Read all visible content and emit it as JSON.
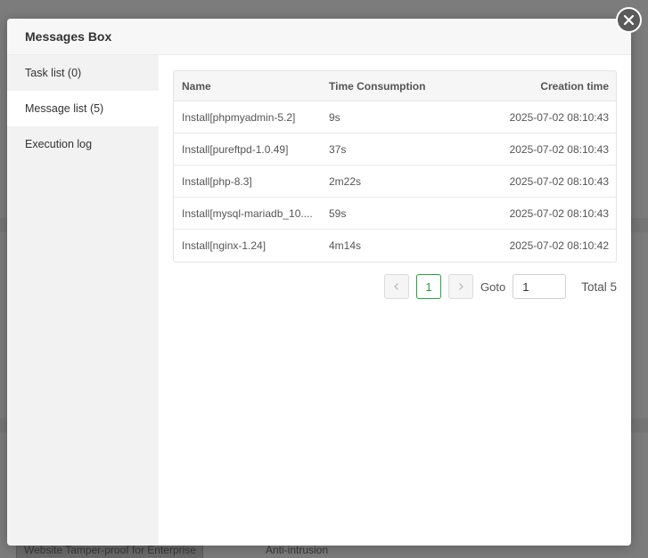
{
  "background": {
    "bottom_left_text": "Website Tamper-proof for Enterprise",
    "bottom_mid_text": "Anti-intrusion"
  },
  "dialog": {
    "title": "Messages Box",
    "close_icon": "close-icon"
  },
  "sidebar": {
    "items": [
      {
        "label": "Task list (0)",
        "active": false
      },
      {
        "label": "Message list (5)",
        "active": true
      },
      {
        "label": "Execution log",
        "active": false
      }
    ]
  },
  "table": {
    "headers": {
      "name": "Name",
      "time": "Time Consumption",
      "created": "Creation time"
    },
    "rows": [
      {
        "name": "Install[phpmyadmin-5.2]",
        "time": "9s",
        "created": "2025-07-02 08:10:43"
      },
      {
        "name": "Install[pureftpd-1.0.49]",
        "time": "37s",
        "created": "2025-07-02 08:10:43"
      },
      {
        "name": "Install[php-8.3]",
        "time": "2m22s",
        "created": "2025-07-02 08:10:43"
      },
      {
        "name": "Install[mysql-mariadb_10....",
        "time": "59s",
        "created": "2025-07-02 08:10:43"
      },
      {
        "name": "Install[nginx-1.24]",
        "time": "4m14s",
        "created": "2025-07-02 08:10:42"
      }
    ]
  },
  "pagination": {
    "prev_icon": "chevron-left-icon",
    "current_page": "1",
    "next_icon": "chevron-right-icon",
    "goto_label": "Goto",
    "goto_value": "1",
    "total_label": "Total 5"
  },
  "colors": {
    "accent": "#20a53a",
    "overlay": "#000000"
  }
}
